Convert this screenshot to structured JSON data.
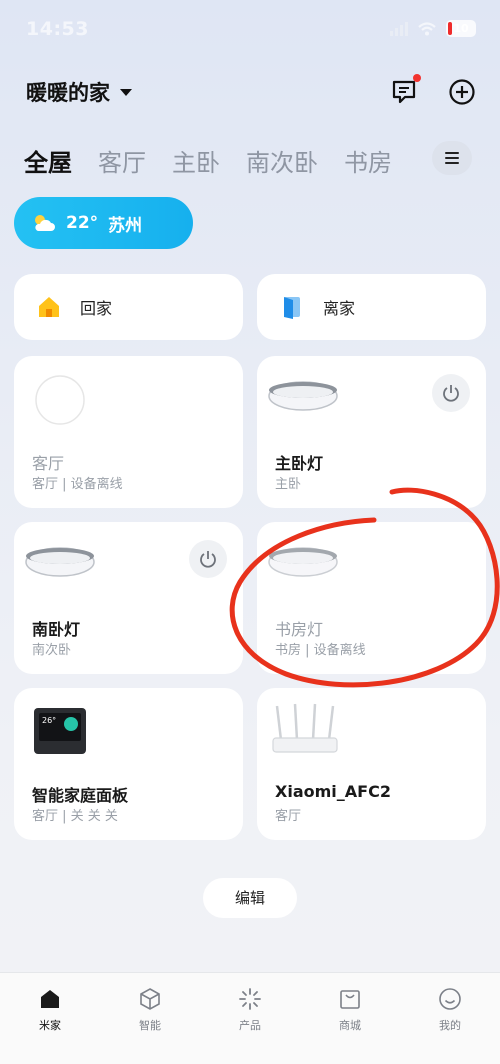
{
  "status_bar": {
    "time": "14:53",
    "battery": "10"
  },
  "header": {
    "home_name": "暖暖的家"
  },
  "tabs": [
    "全屋",
    "客厅",
    "主卧",
    "南次卧",
    "书房"
  ],
  "weather": {
    "temp": "22°",
    "city": "苏州"
  },
  "scenes": [
    {
      "label": "回家",
      "icon": "home-icon"
    },
    {
      "label": "离家",
      "icon": "door-icon"
    }
  ],
  "devices": [
    {
      "name": "客厅",
      "sub": "客厅 | 设备离线",
      "offline": true,
      "icon": "round-device-icon"
    },
    {
      "name": "主卧灯",
      "sub": "主卧",
      "offline": false,
      "icon": "ceiling-lamp-icon",
      "power": true
    },
    {
      "name": "南卧灯",
      "sub": "南次卧",
      "offline": false,
      "icon": "ceiling-lamp-icon",
      "power": true
    },
    {
      "name": "书房灯",
      "sub": "书房 | 设备离线",
      "offline": true,
      "icon": "ceiling-lamp-icon"
    },
    {
      "name": "智能家庭面板",
      "sub": "客厅 | 关 关 关",
      "offline": false,
      "icon": "smart-panel-icon",
      "panel_temp": "26°"
    },
    {
      "name": "Xiaomi_AFC2",
      "sub": "客厅",
      "offline": false,
      "icon": "router-icon"
    }
  ],
  "edit_label": "编辑",
  "nav": [
    {
      "label": "米家",
      "icon": "home-nav-icon",
      "active": true
    },
    {
      "label": "智能",
      "icon": "cube-icon",
      "active": false
    },
    {
      "label": "产品",
      "icon": "sparkle-icon",
      "active": false
    },
    {
      "label": "商城",
      "icon": "shop-bag-icon",
      "active": false
    },
    {
      "label": "我的",
      "icon": "smile-icon",
      "active": false
    }
  ],
  "colors": {
    "accent": "#1bb8f0",
    "annotation": "#e8321c",
    "notification": "#f2332f"
  }
}
